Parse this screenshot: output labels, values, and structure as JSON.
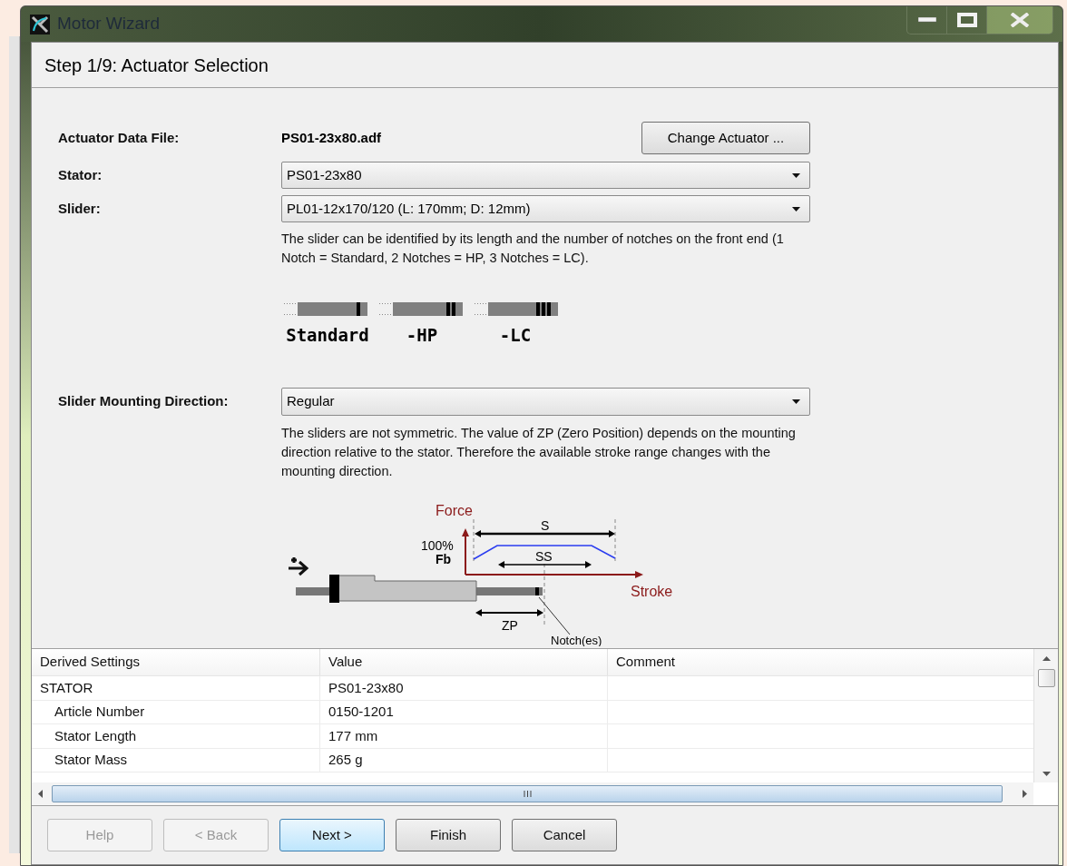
{
  "window": {
    "title": "Motor Wizard"
  },
  "step_title": "Step 1/9: Actuator Selection",
  "actuator_file": {
    "label": "Actuator Data File:",
    "value": "PS01-23x80.adf",
    "button": "Change Actuator ..."
  },
  "dropdowns": [
    {
      "label": "Stator:",
      "value": "PS01-23x80"
    },
    {
      "label": "Slider:",
      "value": "PL01-12x170/120 (L: 170mm; D: 12mm)"
    }
  ],
  "slider_note": "The slider can be identified by its length and the number of notches on the front end (1 Notch = Standard, 2 Notches = HP, 3 Notches = LC).",
  "slider_types": [
    {
      "label": "Standard",
      "kind": "one"
    },
    {
      "label": "-HP",
      "kind": "two"
    },
    {
      "label": "-LC",
      "kind": "three"
    }
  ],
  "mounting": {
    "label": "Slider Mounting Direction:",
    "value": "Regular",
    "note": "The sliders are not symmetric. The value of ZP (Zero Position) depends on the mounting direction relative to the stator. Therefore the available stroke range changes with the mounting direction."
  },
  "diagram": {
    "force": "Force",
    "stroke": "Stroke",
    "full": "100%",
    "fb": "Fb",
    "s": "S",
    "ss": "SS",
    "zp": "ZP",
    "notch": "Notch(es)"
  },
  "table": {
    "columns": [
      "Derived Settings",
      "Value",
      "Comment"
    ],
    "rows": [
      {
        "setting": "STATOR",
        "value": "PS01-23x80",
        "children": [
          {
            "setting": "Article Number",
            "value": "0150-1201"
          },
          {
            "setting": "Stator Length",
            "value": "177 mm"
          },
          {
            "setting": "Stator Mass",
            "value": "265 g"
          }
        ]
      }
    ]
  },
  "buttons": [
    {
      "label": "Help",
      "disabled": true,
      "default": false
    },
    {
      "label": "< Back",
      "disabled": true,
      "default": false
    },
    {
      "label": "Next >",
      "disabled": false,
      "default": true
    },
    {
      "label": "Finish",
      "disabled": false,
      "default": false
    },
    {
      "label": "Cancel",
      "disabled": false,
      "default": false
    }
  ]
}
